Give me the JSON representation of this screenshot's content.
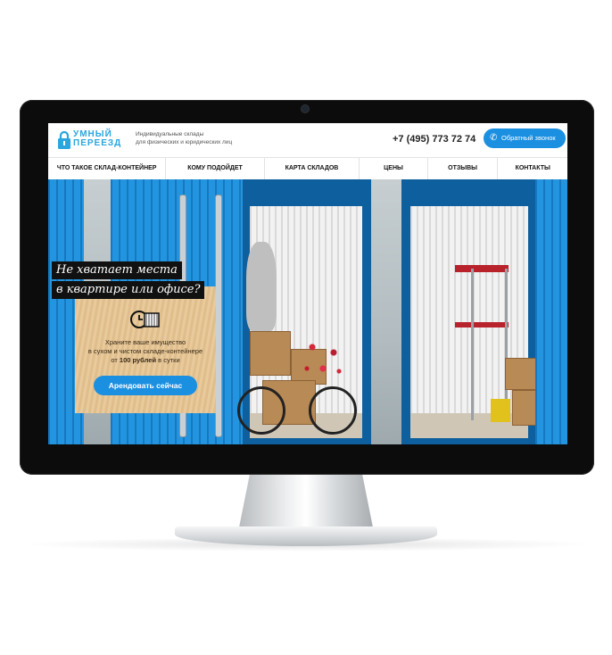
{
  "header": {
    "logo": {
      "line1": "УМНЫЙ",
      "line2": "ПЕРЕЕЗД"
    },
    "tagline": {
      "line1": "Индивидуальные склады",
      "line2": "для физических и юридических лиц"
    },
    "phone": "+7 (495) 773 72 74",
    "callback_label": "Обратный звонок"
  },
  "nav": {
    "items": [
      {
        "label": "ЧТО ТАКОЕ СКЛАД-КОНТЕЙНЕР"
      },
      {
        "label": "КОМУ ПОДОЙДЕТ"
      },
      {
        "label": "КАРТА СКЛАДОВ"
      },
      {
        "label": "ЦЕНЫ"
      },
      {
        "label": "ОТЗЫВЫ"
      },
      {
        "label": "КОНТАКТЫ"
      }
    ]
  },
  "hero": {
    "headline_line1": "Не хватает места",
    "headline_line2": "в квартире или офисе?",
    "text_line1": "Храните ваше имущество",
    "text_line2": "в сухом и чистом складе-контейнере",
    "text_line3_prefix": "от",
    "text_line3_price": "100 рублей",
    "text_line3_suffix": "в сутки",
    "cta_label": "Арендовать сейчас"
  },
  "colors": {
    "accent": "#1b8fe0",
    "logo": "#2aa6de",
    "container_blue": "#1d8ad6",
    "promo_wood": "#e6c694"
  },
  "icons": [
    "lock-icon",
    "phone-icon",
    "box-clock-icon"
  ]
}
